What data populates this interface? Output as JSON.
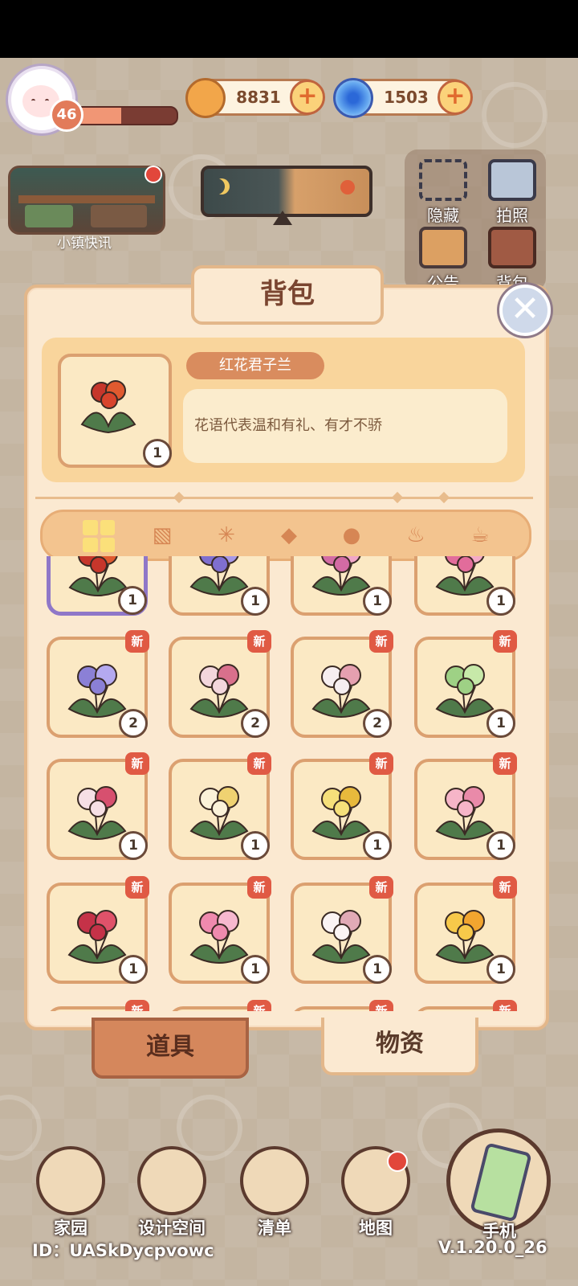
{
  "hud": {
    "level": "46",
    "xp_fraction": 0.45,
    "coins": "8831",
    "gems": "1503"
  },
  "news": {
    "label": "小镇快讯"
  },
  "side": {
    "hide": "隐藏",
    "photo": "拍照",
    "notice": "公告",
    "bag": "背包"
  },
  "panel": {
    "title": "背包",
    "selected_item": {
      "name": "红花君子兰",
      "description": "花语代表温和有礼、有才不骄",
      "count": "1"
    },
    "categories": [
      "grid-icon",
      "seed-icon",
      "branch-icon",
      "fish-icon",
      "drumstick-icon",
      "soup-bowl-icon",
      "teacup-icon"
    ],
    "new_label": "新",
    "items": [
      {
        "count": "1",
        "new": false,
        "colors": [
          "#c6362b",
          "#e05a2f"
        ],
        "selected": true
      },
      {
        "count": "1",
        "new": false,
        "colors": [
          "#7f6fd0",
          "#a698e8"
        ]
      },
      {
        "count": "1",
        "new": false,
        "colors": [
          "#d36ba4",
          "#f1a6c8"
        ]
      },
      {
        "count": "1",
        "new": false,
        "colors": [
          "#e26c9b",
          "#f5aac7"
        ]
      },
      {
        "count": "2",
        "new": true,
        "colors": [
          "#8b80d6",
          "#b4a9f0"
        ]
      },
      {
        "count": "2",
        "new": true,
        "colors": [
          "#f3d6dc",
          "#d9708c"
        ]
      },
      {
        "count": "2",
        "new": true,
        "colors": [
          "#f6eef0",
          "#e5a0b0"
        ]
      },
      {
        "count": "1",
        "new": true,
        "colors": [
          "#9ed185",
          "#c7e9a9"
        ]
      },
      {
        "count": "1",
        "new": true,
        "colors": [
          "#f6dfe5",
          "#d7506f"
        ]
      },
      {
        "count": "1",
        "new": true,
        "colors": [
          "#fbf2d9",
          "#efd271"
        ]
      },
      {
        "count": "1",
        "new": true,
        "colors": [
          "#f6e07a",
          "#e8b93c"
        ]
      },
      {
        "count": "1",
        "new": true,
        "colors": [
          "#f6b5c8",
          "#e98aa9"
        ]
      },
      {
        "count": "1",
        "new": true,
        "colors": [
          "#c53248",
          "#e0526a"
        ]
      },
      {
        "count": "1",
        "new": true,
        "colors": [
          "#ef8aae",
          "#f7b8cf"
        ]
      },
      {
        "count": "1",
        "new": true,
        "colors": [
          "#fbf4f4",
          "#e1aab6"
        ]
      },
      {
        "count": "1",
        "new": true,
        "colors": [
          "#f7c94a",
          "#f2a52f"
        ]
      },
      {
        "count": "",
        "new": true,
        "colors": [
          "#f2d4b4",
          "#f2d4b4"
        ]
      },
      {
        "count": "",
        "new": true,
        "colors": [
          "#f2d4b4",
          "#f2d4b4"
        ]
      },
      {
        "count": "",
        "new": true,
        "colors": [
          "#f2d4b4",
          "#f2d4b4"
        ]
      },
      {
        "count": "",
        "new": true,
        "colors": [
          "#f2d4b4",
          "#f2d4b4"
        ]
      }
    ]
  },
  "tabs": {
    "tools": "道具",
    "goods": "物资"
  },
  "bottom_nav": {
    "home": "家园",
    "design": "设计空间",
    "list": "清单",
    "map": "地图",
    "phone": "手机"
  },
  "footer": {
    "id": "ID：UASkDycpvowc",
    "version": "V.1.20.0_26"
  }
}
